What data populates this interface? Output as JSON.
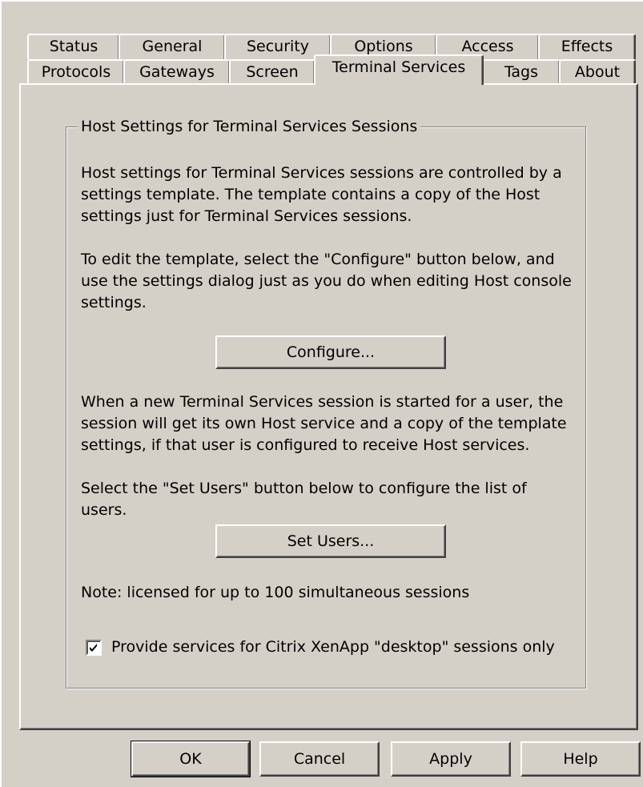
{
  "tabs": {
    "row1": [
      {
        "label": "Status"
      },
      {
        "label": "General"
      },
      {
        "label": "Security"
      },
      {
        "label": "Options"
      },
      {
        "label": "Access"
      },
      {
        "label": "Effects"
      }
    ],
    "row2": [
      {
        "label": "Protocols"
      },
      {
        "label": "Gateways"
      },
      {
        "label": "Screen"
      },
      {
        "label": "Terminal Services",
        "selected": true
      },
      {
        "label": "Tags"
      },
      {
        "label": "About"
      }
    ]
  },
  "group": {
    "title": "Host Settings for Terminal Services Sessions",
    "intro": "Host settings for Terminal Services sessions are controlled by a settings template.  The template contains a copy of the Host settings just for Terminal Services sessions.",
    "edit_instructions": "To edit the template, select the \"Configure\" button below, and use the settings dialog just as you do when editing Host console settings.",
    "configure_label": "Configure...",
    "session_info": "When a new Terminal Services session is started for a user, the session will get its own Host service and a copy of the template settings, if that user is configured to receive Host services.",
    "set_users_instructions": "Select the \"Set Users\" button below to configure the list of users.",
    "set_users_label": "Set Users...",
    "license_note": "Note: licensed for up to 100 simultaneous sessions",
    "desktop_only_label": "Provide services for Citrix XenApp \"desktop\" sessions only",
    "desktop_only_checked": true
  },
  "buttons": {
    "ok": "OK",
    "cancel": "Cancel",
    "apply": "Apply",
    "help": "Help"
  }
}
